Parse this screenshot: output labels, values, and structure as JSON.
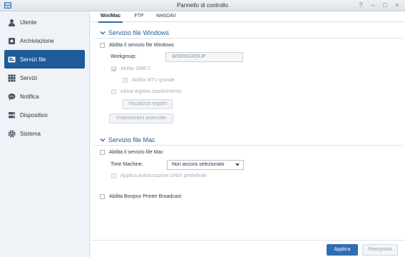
{
  "window": {
    "title": "Pannello di controllo",
    "controls": [
      "?",
      "–",
      "□",
      "×"
    ]
  },
  "sidebar": {
    "items": [
      {
        "label": "Utente",
        "icon": "user-icon"
      },
      {
        "label": "Archiviazione",
        "icon": "storage-icon"
      },
      {
        "label": "Servizi file",
        "icon": "file-services-icon",
        "active": true
      },
      {
        "label": "Servizi",
        "icon": "grid-icon"
      },
      {
        "label": "Notifica",
        "icon": "chat-icon"
      },
      {
        "label": "Dispositivo",
        "icon": "device-icon"
      },
      {
        "label": "Sistema",
        "icon": "gear-icon"
      }
    ]
  },
  "tabs": [
    "Win/Mac",
    "FTP",
    "WebDAV"
  ],
  "windows_section": {
    "title": "Servizio file Windows",
    "enable_label": "Abilita il servizio file Windows",
    "workgroup_label": "Workgroup:",
    "workgroup_value": "WORKGROUP",
    "smb2_label": "Abilita SMB 2",
    "mtu_label": "Abilita MTU grande",
    "log_label": "Attiva registro trasferimento",
    "view_logs_button": "Visualizza registri",
    "advanced_button": "Impostazioni avanzate"
  },
  "mac_section": {
    "title": "Servizio file Mac",
    "enable_label": "Abilita il servizio file Mac",
    "time_machine_label": "Time Machine:",
    "time_machine_value": "Non ancora selezionato",
    "unix_label": "Applica autorizzazioni UNIX predefinite"
  },
  "bonjour_label": "Abilita Bonjour Printer Broadcast",
  "footer": {
    "apply": "Applica",
    "reset": "Reimposta"
  },
  "colors": {
    "accent": "#1f5b98",
    "primary_button": "#2e6db4"
  }
}
